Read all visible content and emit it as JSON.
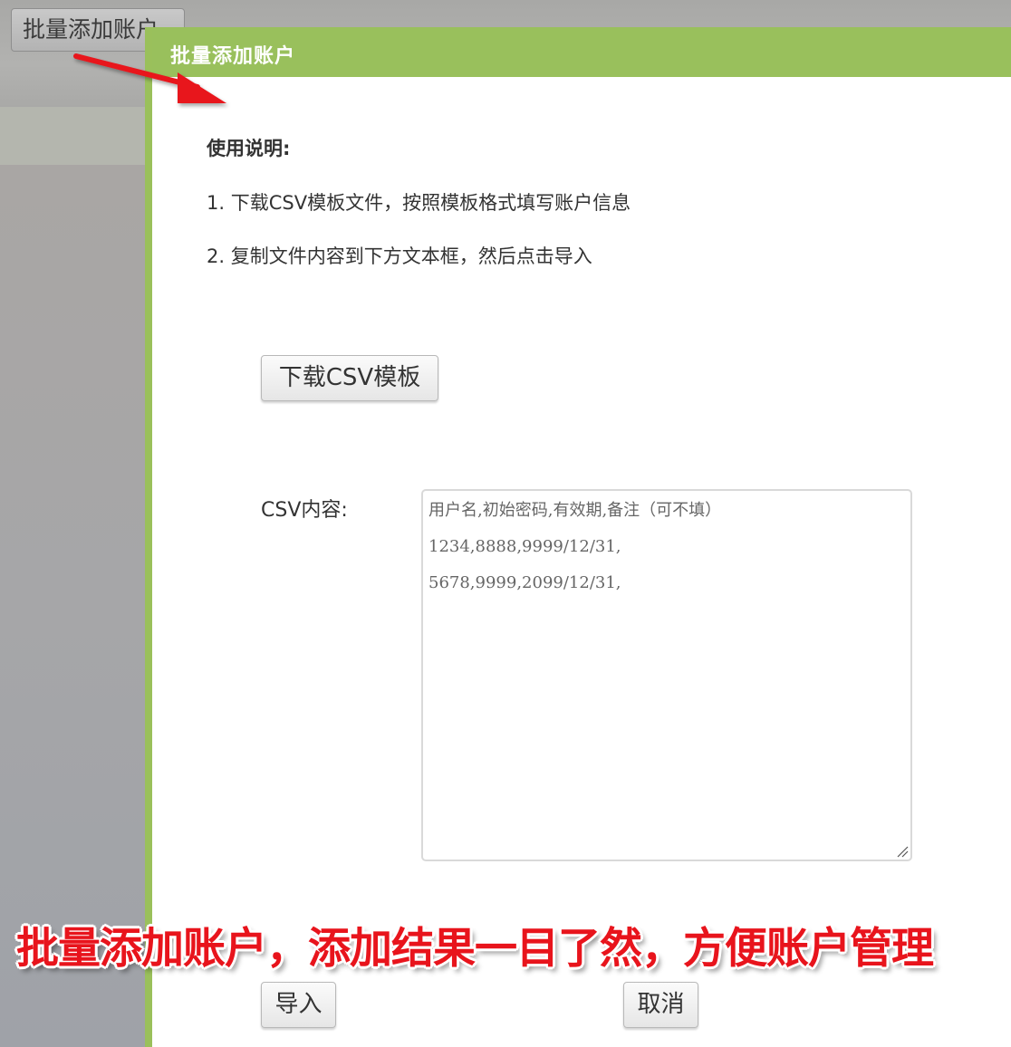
{
  "background": {
    "button_label": "批量添加账户"
  },
  "modal": {
    "title": "批量添加账户",
    "instructions": {
      "heading": "使用说明:",
      "step1": "1. 下载CSV模板文件，按照模板格式填写账户信息",
      "step2": "2. 复制文件内容到下方文本框，然后点击导入"
    },
    "download_button": "下载CSV模板",
    "csv_label": "CSV内容:",
    "csv_lines": [
      "用户名,初始密码,有效期,备注（可不填）",
      "1234,8888,9999/12/31,",
      "5678,9999,2099/12/31,"
    ],
    "import_button": "导入",
    "cancel_button": "取消"
  },
  "annotation": {
    "promo_text": "批量添加账户，添加结果一目了然，方便账户管理"
  },
  "colors": {
    "header_green": "#99c05c",
    "arrow_red": "#e8141c"
  }
}
